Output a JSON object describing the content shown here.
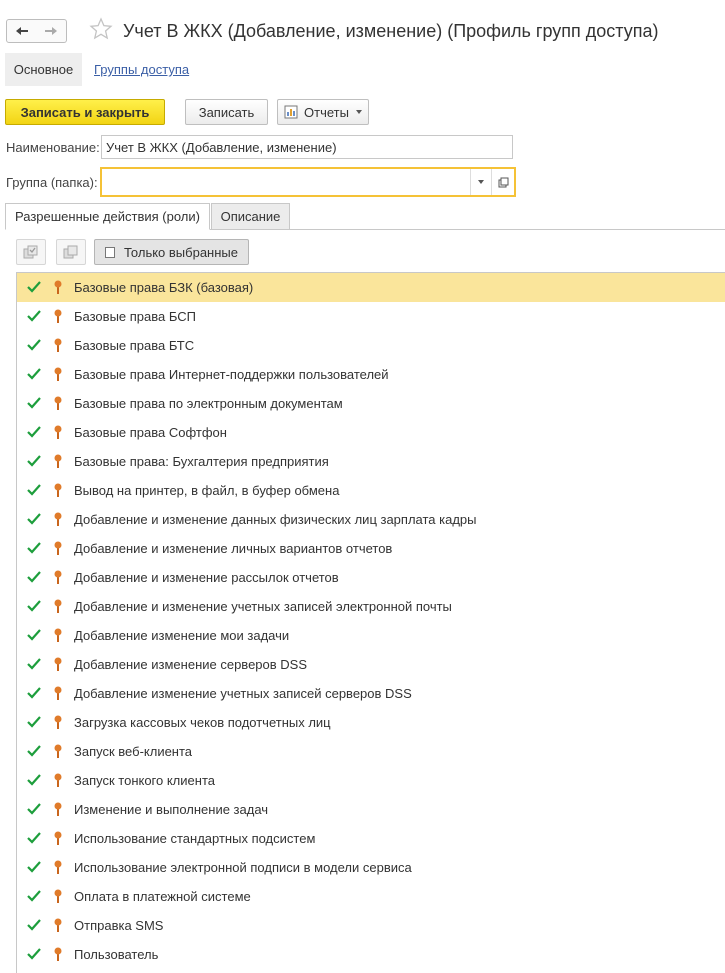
{
  "window": {
    "title": "Учет В ЖКХ (Добавление, изменение) (Профиль групп доступа)"
  },
  "sections": {
    "main": "Основное",
    "link": "Группы доступа"
  },
  "toolbar": {
    "save_close": "Записать и закрыть",
    "save": "Записать",
    "reports": "Отчеты"
  },
  "form": {
    "name_label": "Наименование:",
    "name_value": "Учет В ЖКХ (Добавление, изменение)",
    "group_label": "Группа (папка):",
    "group_value": ""
  },
  "tabs": [
    {
      "label": "Разрешенные действия (роли)",
      "active": true
    },
    {
      "label": "Описание",
      "active": false
    }
  ],
  "roles_toolbar": {
    "only_selected": "Только выбранные"
  },
  "roles": [
    {
      "label": "Базовые права БЗК (базовая)",
      "checked": true,
      "selected": true
    },
    {
      "label": "Базовые права БСП",
      "checked": true
    },
    {
      "label": "Базовые права БТС",
      "checked": true
    },
    {
      "label": "Базовые права Интернет-поддержки пользователей",
      "checked": true
    },
    {
      "label": "Базовые права по электронным документам",
      "checked": true
    },
    {
      "label": "Базовые права Софтфон",
      "checked": true
    },
    {
      "label": "Базовые права: Бухгалтерия предприятия",
      "checked": true
    },
    {
      "label": "Вывод на принтер, в файл, в буфер обмена",
      "checked": true
    },
    {
      "label": "Добавление и изменение данных физических лиц зарплата кадры",
      "checked": true
    },
    {
      "label": "Добавление и изменение личных вариантов отчетов",
      "checked": true
    },
    {
      "label": "Добавление и изменение рассылок отчетов",
      "checked": true
    },
    {
      "label": "Добавление и изменение учетных записей электронной почты",
      "checked": true
    },
    {
      "label": "Добавление изменение мои задачи",
      "checked": true
    },
    {
      "label": "Добавление изменение серверов DSS",
      "checked": true
    },
    {
      "label": "Добавление изменение учетных записей серверов DSS",
      "checked": true
    },
    {
      "label": "Загрузка кассовых чеков подотчетных лиц",
      "checked": true
    },
    {
      "label": "Запуск веб-клиента",
      "checked": true
    },
    {
      "label": "Запуск тонкого клиента",
      "checked": true
    },
    {
      "label": "Изменение и выполнение задач",
      "checked": true
    },
    {
      "label": "Использование стандартных подсистем",
      "checked": true
    },
    {
      "label": "Использование электронной подписи в модели сервиса",
      "checked": true
    },
    {
      "label": "Оплата в платежной системе",
      "checked": true
    },
    {
      "label": "Отправка SMS",
      "checked": true
    },
    {
      "label": "Пользователь",
      "checked": true
    }
  ],
  "colors": {
    "accent_yellow": "#f2d414",
    "selected_row": "#fae59b",
    "check_green": "#1d9e3c",
    "role_icon": "#e07b2a",
    "link_blue": "#3b5fa6"
  }
}
